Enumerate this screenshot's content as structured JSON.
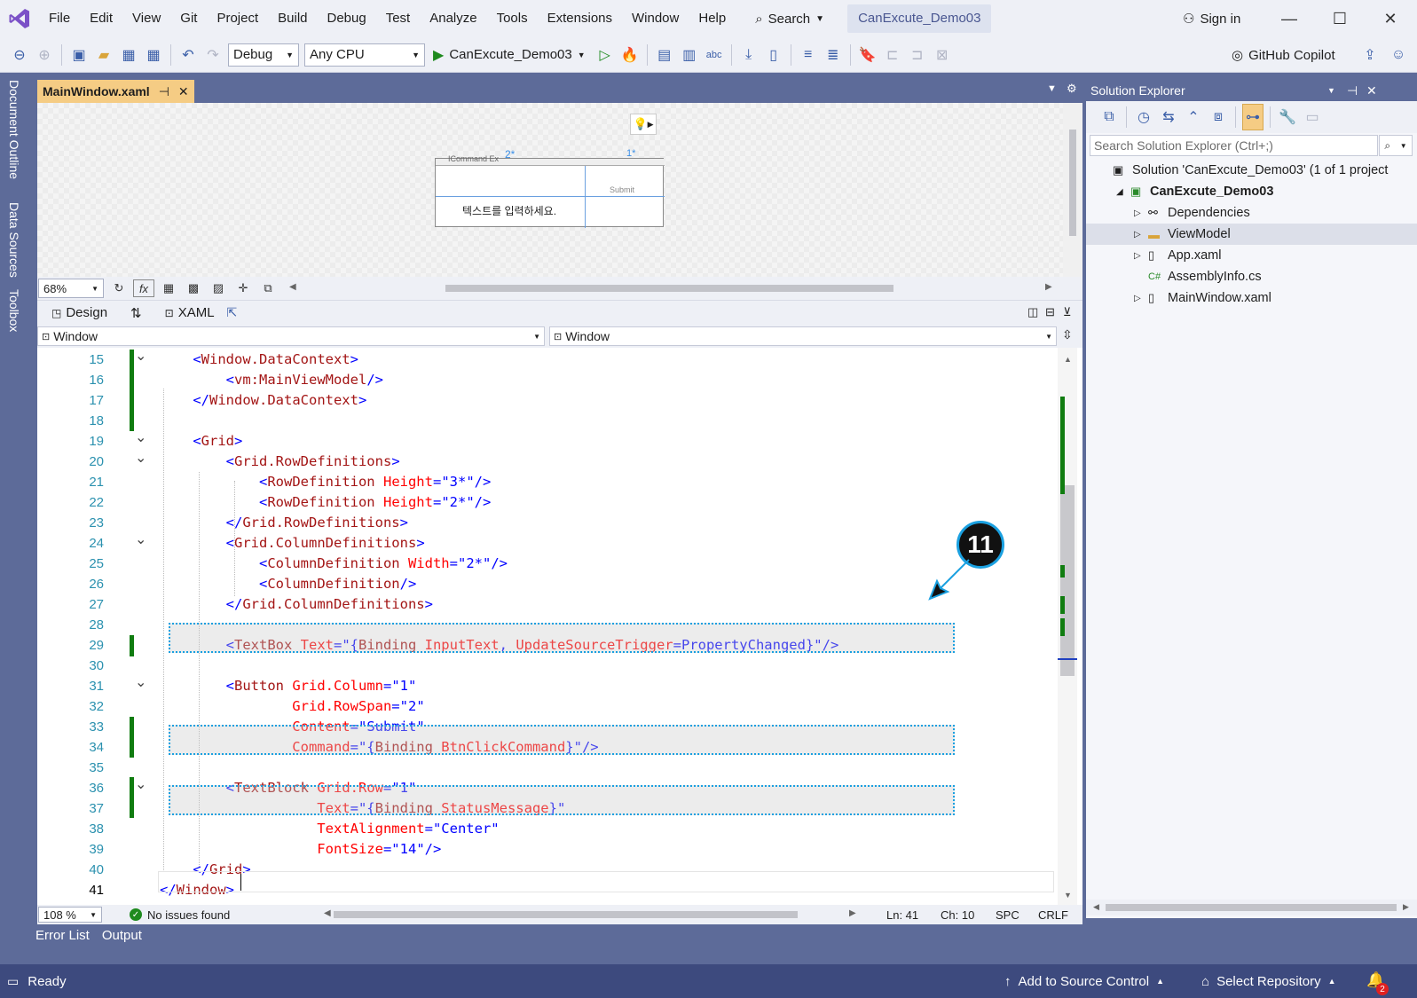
{
  "menu": {
    "items": [
      "File",
      "Edit",
      "View",
      "Git",
      "Project",
      "Build",
      "Debug",
      "Test",
      "Analyze",
      "Tools",
      "Extensions",
      "Window",
      "Help"
    ],
    "search_label": "Search",
    "solution_title": "CanExcute_Demo03",
    "sign_in": "Sign in"
  },
  "toolbar": {
    "config": "Debug",
    "platform": "Any CPU",
    "run_label": "CanExcute_Demo03",
    "copilot": "GitHub Copilot"
  },
  "left_rail": {
    "tabs": [
      "Document Outline",
      "Data Sources",
      "Toolbox"
    ]
  },
  "editor_tab": {
    "label": "MainWindow.xaml"
  },
  "designer": {
    "zoom": "68%",
    "preview_command_label": "ICommand Ex",
    "preview_placeholder": "텍스트를 입력하세요.",
    "preview_button": "Submit",
    "grid_col_marker": "2*",
    "grid_col_marker2": "1*"
  },
  "split": {
    "design_label": "Design",
    "xaml_label": "XAML"
  },
  "nav": {
    "left": "Window",
    "right": "Window"
  },
  "code_lines": [
    {
      "n": "15",
      "fold": "v",
      "segs": [
        [
          "br",
          "    <"
        ],
        [
          "tag",
          "Window.DataContext"
        ],
        [
          "br",
          ">"
        ]
      ]
    },
    {
      "n": "16",
      "fold": "",
      "segs": [
        [
          "br",
          "        <"
        ],
        [
          "tag",
          "vm:MainViewModel"
        ],
        [
          "br",
          "/>"
        ]
      ]
    },
    {
      "n": "17",
      "fold": "",
      "segs": [
        [
          "br",
          "    </"
        ],
        [
          "tag",
          "Window.DataContext"
        ],
        [
          "br",
          ">"
        ]
      ]
    },
    {
      "n": "18",
      "fold": "",
      "segs": []
    },
    {
      "n": "19",
      "fold": "v",
      "segs": [
        [
          "br",
          "    <"
        ],
        [
          "tag",
          "Grid"
        ],
        [
          "br",
          ">"
        ]
      ]
    },
    {
      "n": "20",
      "fold": "v",
      "segs": [
        [
          "br",
          "        <"
        ],
        [
          "tag",
          "Grid.RowDefinitions"
        ],
        [
          "br",
          ">"
        ]
      ]
    },
    {
      "n": "21",
      "fold": "",
      "segs": [
        [
          "br",
          "            <"
        ],
        [
          "tag",
          "RowDefinition "
        ],
        [
          "at",
          "Height"
        ],
        [
          "br",
          "=\""
        ],
        [
          "vl",
          "3*"
        ],
        [
          "br",
          "\"/>"
        ]
      ]
    },
    {
      "n": "22",
      "fold": "",
      "segs": [
        [
          "br",
          "            <"
        ],
        [
          "tag",
          "RowDefinition "
        ],
        [
          "at",
          "Height"
        ],
        [
          "br",
          "=\""
        ],
        [
          "vl",
          "2*"
        ],
        [
          "br",
          "\"/>"
        ]
      ]
    },
    {
      "n": "23",
      "fold": "",
      "segs": [
        [
          "br",
          "        </"
        ],
        [
          "tag",
          "Grid.RowDefinitions"
        ],
        [
          "br",
          ">"
        ]
      ]
    },
    {
      "n": "24",
      "fold": "v",
      "segs": [
        [
          "br",
          "        <"
        ],
        [
          "tag",
          "Grid.ColumnDefinitions"
        ],
        [
          "br",
          ">"
        ]
      ]
    },
    {
      "n": "25",
      "fold": "",
      "segs": [
        [
          "br",
          "            <"
        ],
        [
          "tag",
          "ColumnDefinition "
        ],
        [
          "at",
          "Width"
        ],
        [
          "br",
          "=\""
        ],
        [
          "vl",
          "2*"
        ],
        [
          "br",
          "\"/>"
        ]
      ]
    },
    {
      "n": "26",
      "fold": "",
      "segs": [
        [
          "br",
          "            <"
        ],
        [
          "tag",
          "ColumnDefinition"
        ],
        [
          "br",
          "/>"
        ]
      ]
    },
    {
      "n": "27",
      "fold": "",
      "segs": [
        [
          "br",
          "        </"
        ],
        [
          "tag",
          "Grid.ColumnDefinitions"
        ],
        [
          "br",
          ">"
        ]
      ]
    },
    {
      "n": "28",
      "fold": "",
      "segs": []
    },
    {
      "n": "29",
      "fold": "",
      "segs": [
        [
          "br",
          "        <"
        ],
        [
          "tag",
          "TextBox "
        ],
        [
          "at",
          "Text"
        ],
        [
          "br",
          "=\"{"
        ],
        [
          "tag",
          "Binding "
        ],
        [
          "at",
          "InputText"
        ],
        [
          "br",
          ", "
        ],
        [
          "at",
          "UpdateSourceTrigger"
        ],
        [
          "br",
          "="
        ],
        [
          "vl",
          "PropertyChanged"
        ],
        [
          "br",
          "}\"/>"
        ]
      ]
    },
    {
      "n": "30",
      "fold": "",
      "segs": []
    },
    {
      "n": "31",
      "fold": "v",
      "segs": [
        [
          "br",
          "        <"
        ],
        [
          "tag",
          "Button "
        ],
        [
          "at",
          "Grid.Column"
        ],
        [
          "br",
          "=\""
        ],
        [
          "vl",
          "1"
        ],
        [
          "br",
          "\""
        ]
      ]
    },
    {
      "n": "32",
      "fold": "",
      "segs": [
        [
          "at",
          "                Grid.RowSpan"
        ],
        [
          "br",
          "=\""
        ],
        [
          "vl",
          "2"
        ],
        [
          "br",
          "\""
        ]
      ]
    },
    {
      "n": "33",
      "fold": "",
      "segs": [
        [
          "at",
          "                Content"
        ],
        [
          "br",
          "=\""
        ],
        [
          "vl",
          "Submit"
        ],
        [
          "br",
          "\""
        ]
      ]
    },
    {
      "n": "34",
      "fold": "",
      "segs": [
        [
          "at",
          "                Command"
        ],
        [
          "br",
          "=\"{"
        ],
        [
          "tag",
          "Binding "
        ],
        [
          "at",
          "BtnClickCommand"
        ],
        [
          "br",
          "}\"/>"
        ]
      ]
    },
    {
      "n": "35",
      "fold": "",
      "segs": []
    },
    {
      "n": "36",
      "fold": "v",
      "segs": [
        [
          "br",
          "        <"
        ],
        [
          "tag",
          "TextBlock "
        ],
        [
          "at",
          "Grid.Row"
        ],
        [
          "br",
          "=\""
        ],
        [
          "vl",
          "1"
        ],
        [
          "br",
          "\""
        ]
      ]
    },
    {
      "n": "37",
      "fold": "",
      "segs": [
        [
          "at",
          "                   Text"
        ],
        [
          "br",
          "=\"{"
        ],
        [
          "tag",
          "Binding "
        ],
        [
          "at",
          "StatusMessage"
        ],
        [
          "br",
          "}\""
        ]
      ]
    },
    {
      "n": "38",
      "fold": "",
      "segs": [
        [
          "at",
          "                   TextAlignment"
        ],
        [
          "br",
          "=\""
        ],
        [
          "vl",
          "Center"
        ],
        [
          "br",
          "\""
        ]
      ]
    },
    {
      "n": "39",
      "fold": "",
      "segs": [
        [
          "at",
          "                   FontSize"
        ],
        [
          "br",
          "=\""
        ],
        [
          "vl",
          "14"
        ],
        [
          "br",
          "\"/>"
        ]
      ]
    },
    {
      "n": "40",
      "fold": "",
      "segs": [
        [
          "br",
          "    </"
        ],
        [
          "tag",
          "Grid"
        ],
        [
          "br",
          ">"
        ]
      ]
    },
    {
      "n": "41",
      "fold": "",
      "segs": [
        [
          "br",
          "</"
        ],
        [
          "tag",
          "Window"
        ],
        [
          "br",
          ">"
        ]
      ]
    }
  ],
  "callout": {
    "number": "11"
  },
  "editor_status": {
    "zoom": "108 %",
    "issues": "No issues found",
    "line": "Ln: 41",
    "col": "Ch: 10",
    "spc": "SPC",
    "crlf": "CRLF"
  },
  "solution_explorer": {
    "title": "Solution Explorer",
    "search_placeholder": "Search Solution Explorer (Ctrl+;)",
    "items": [
      {
        "label": "Solution 'CanExcute_Demo03' (1 of 1 project",
        "icon": "solution-icon",
        "indent": 0,
        "arrow": ""
      },
      {
        "label": "CanExcute_Demo03",
        "icon": "csproj-icon",
        "indent": 1,
        "arrow": "◢",
        "bold": true
      },
      {
        "label": "Dependencies",
        "icon": "dependencies-icon",
        "indent": 2,
        "arrow": "▷"
      },
      {
        "label": "ViewModel",
        "icon": "folder-icon",
        "indent": 2,
        "arrow": "▷",
        "selected": true
      },
      {
        "label": "App.xaml",
        "icon": "xaml-file-icon",
        "indent": 2,
        "arrow": "▷"
      },
      {
        "label": "AssemblyInfo.cs",
        "icon": "csharp-file-icon",
        "indent": 2,
        "arrow": ""
      },
      {
        "label": "MainWindow.xaml",
        "icon": "xaml-file-icon",
        "indent": 2,
        "arrow": "▷"
      }
    ]
  },
  "bottom_tabs": [
    "Error List",
    "Output"
  ],
  "status": {
    "ready": "Ready",
    "source_control": "Add to Source Control",
    "repo": "Select Repository",
    "notifications": "2"
  },
  "colors": {
    "accent": "#5d6b99",
    "statusbar": "#3d4a7e",
    "tab_active": "#f5cc84",
    "git_bar": "#107c10",
    "highlight_border": "#1aa0e0"
  }
}
